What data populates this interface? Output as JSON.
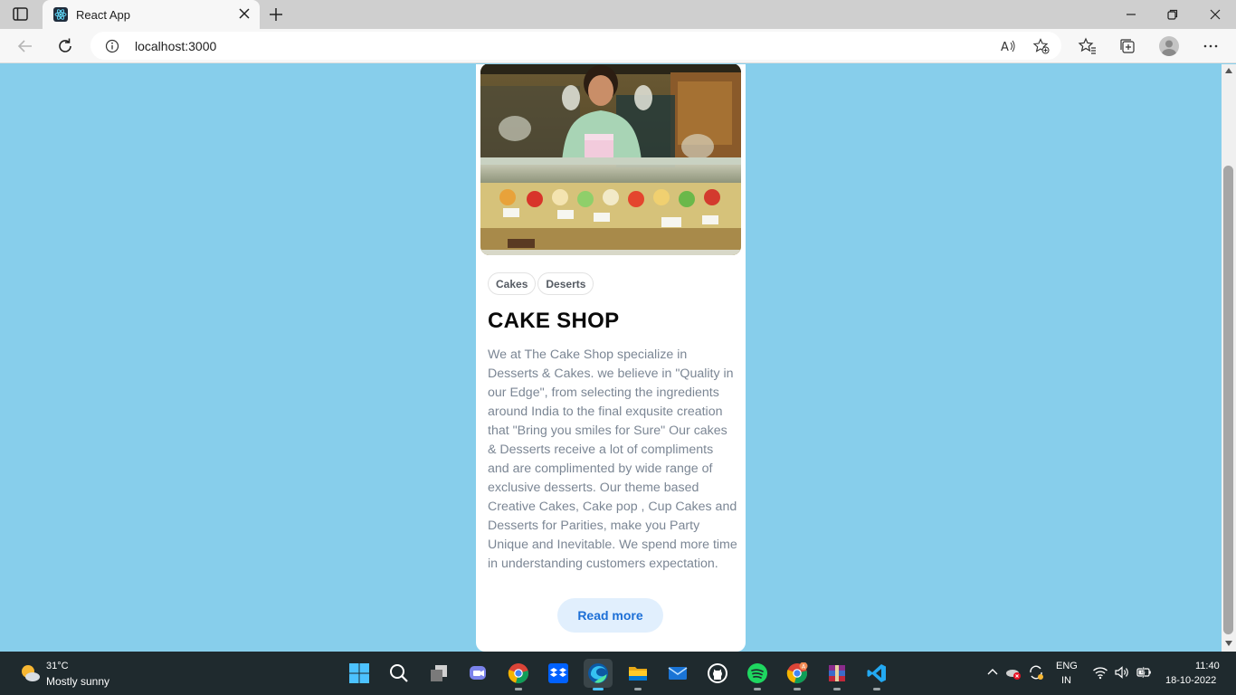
{
  "browser": {
    "tab_title": "React App",
    "url": "localhost:3000"
  },
  "card": {
    "tags": [
      "Cakes",
      "Deserts"
    ],
    "title": "CAKE SHOP",
    "description": "We at The Cake Shop specialize in Desserts & Cakes. we believe in \"Quality in our Edge\", from selecting the ingredients around India to the final exqusite creation that \"Bring you smiles for Sure\" Our cakes & Desserts receive a lot of compliments and are complimented by wide range of exclusive desserts. Our theme based Creative Cakes, Cake pop , Cup Cakes and Desserts for Parities, make you Party Unique and Inevitable. We spend more time in understanding customers expectation.",
    "button_label": "Read more"
  },
  "colors": {
    "page_background": "#87ceeb",
    "card_background": "#ffffff",
    "button_background": "#e1effd",
    "button_text": "#1d6fd6"
  },
  "taskbar": {
    "weather_temp": "31°C",
    "weather_desc": "Mostly sunny",
    "pinned_apps": [
      "start-icon",
      "search-icon",
      "task-view-icon",
      "teams-chat-icon",
      "chrome-icon",
      "dropbox-icon",
      "edge-icon",
      "file-explorer-icon",
      "mail-icon",
      "github-icon",
      "spotify-icon",
      "chrome-profile-icon",
      "winrar-icon",
      "vscode-icon"
    ],
    "lang_line1": "ENG",
    "lang_line2": "IN",
    "time": "11:40",
    "date": "18-10-2022"
  }
}
